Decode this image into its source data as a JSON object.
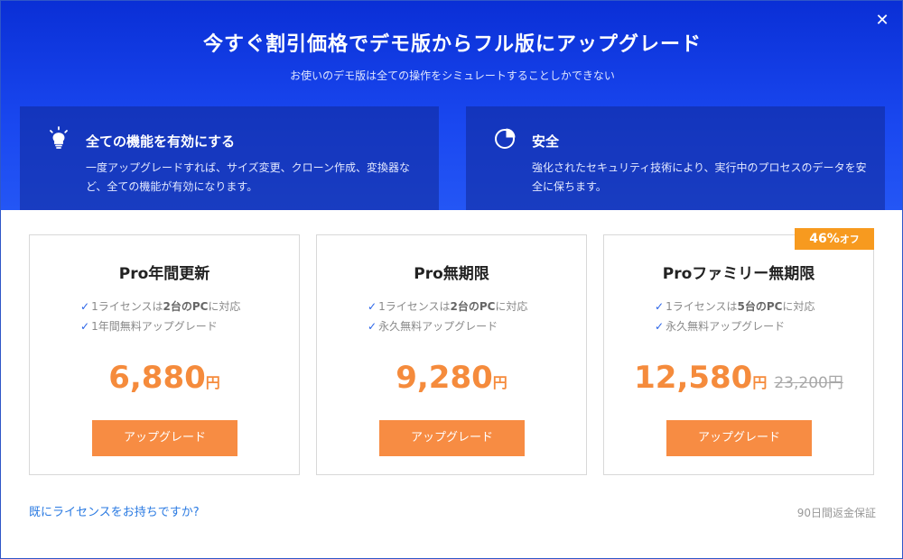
{
  "header": {
    "title": "今すぐ割引価格でデモ版からフル版にアップグレード",
    "subtitle": "お使いのデモ版は全ての操作をシミュレートすることしかできない",
    "close_label": "✕"
  },
  "features": [
    {
      "icon": "lightbulb-icon",
      "title": "全ての機能を有効にする",
      "description": "一度アップグレードすれば、サイズ変更、クローン作成、変換器など、全ての機能が有効になります。"
    },
    {
      "icon": "shield-pie-icon",
      "title": "安全",
      "description": "強化されたセキュリティ技術により、実行中のプロセスのデータを安全に保ちます。"
    }
  ],
  "plans": [
    {
      "name": "Pro年間更新",
      "feature1_pre": "1ライセンスは",
      "feature1_bold": "2台のPC",
      "feature1_post": "に対応",
      "feature2": "1年間無料アップグレード",
      "price": "6,880",
      "currency": "円",
      "button": "アップグレード"
    },
    {
      "name": "Pro無期限",
      "feature1_pre": "1ライセンスは",
      "feature1_bold": "2台のPC",
      "feature1_post": "に対応",
      "feature2": "永久無料アップグレード",
      "price": "9,280",
      "currency": "円",
      "button": "アップグレード"
    },
    {
      "name": "Proファミリー無期限",
      "feature1_pre": "1ライセンスは",
      "feature1_bold": "5台のPC",
      "feature1_post": "に対応",
      "feature2": "永久無料アップグレード",
      "price": "12,580",
      "currency": "円",
      "old_price": "23,200円",
      "button": "アップグレード",
      "badge_percent": "46%",
      "badge_suffix": "オフ"
    }
  ],
  "footer": {
    "license_link": "既にライセンスをお持ちですか?",
    "guarantee": "90日間返金保証"
  },
  "colors": {
    "header_blue": "#1a48f0",
    "accent_orange": "#f78c43",
    "badge_orange": "#f79a1f",
    "check_blue": "#2a64e8",
    "link_blue": "#2a7ae2"
  }
}
